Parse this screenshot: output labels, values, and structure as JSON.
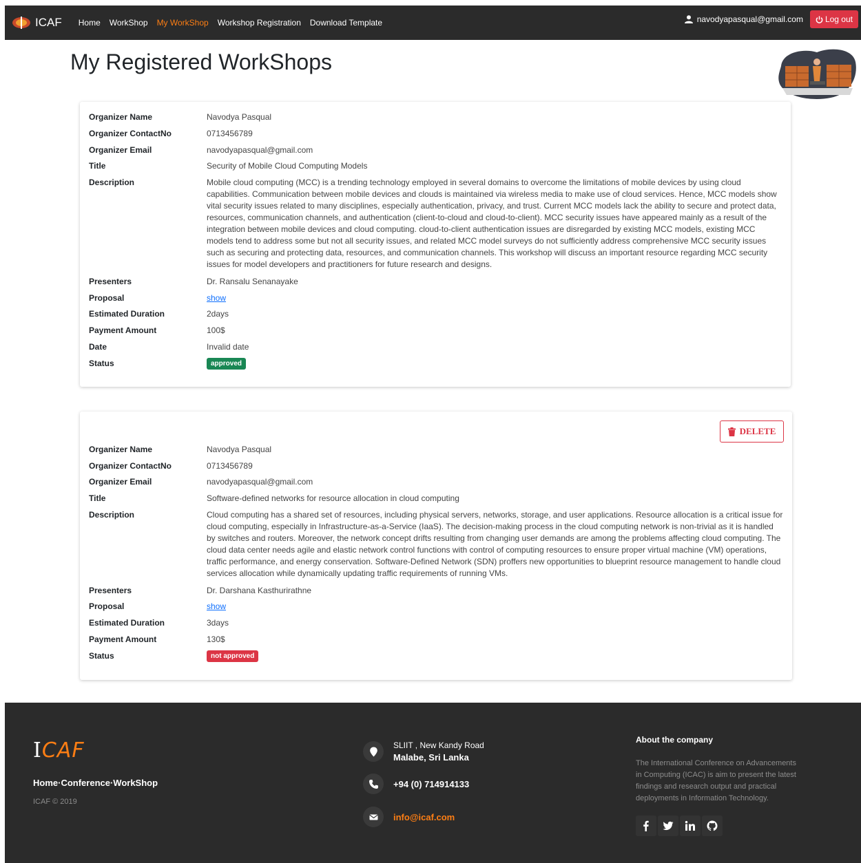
{
  "navbar": {
    "brand": "ICAF",
    "links": [
      "Home",
      "WorkShop",
      "My WorkShop",
      "Workshop Registration",
      "Download Template"
    ],
    "active_index": 2,
    "user_email": "navodyapasqual@gmail.com",
    "logout_label": "Log out"
  },
  "page": {
    "title": "My Registered WorkShops"
  },
  "labels": {
    "organizer_name": "Organizer Name",
    "organizer_contact": "Organizer ContactNo",
    "organizer_email": "Organizer Email",
    "title": "Title",
    "description": "Description",
    "presenters": "Presenters",
    "proposal": "Proposal",
    "duration": "Estimated Duration",
    "payment": "Payment Amount",
    "date": "Date",
    "status": "Status"
  },
  "workshops": [
    {
      "organizer_name": "Navodya Pasqual",
      "organizer_contact": "0713456789",
      "organizer_email": "navodyapasqual@gmail.com",
      "title": "Security of Mobile Cloud Computing Models",
      "description": "Mobile cloud computing (MCC) is a trending technology employed in several domains to overcome the limitations of mobile devices by using cloud capabilities. Communication between mobile devices and clouds is maintained via wireless media to make use of cloud services. Hence, MCC models show vital security issues related to many disciplines, especially authentication, privacy, and trust. Current MCC models lack the ability to secure and protect data, resources, communication channels, and authentication (client-to-cloud and cloud-to-client). MCC security issues have appeared mainly as a result of the integration between mobile devices and cloud computing. cloud-to-client authentication issues are disregarded by existing MCC models, existing MCC models tend to address some but not all security issues, and related MCC model surveys do not sufficiently address comprehensive MCC security issues such as securing and protecting data, resources, and communication channels. This workshop will discuss an important resource regarding MCC security issues for model developers and practitioners for future research and designs.",
      "presenters": "Dr. Ransalu Senanayake",
      "proposal": "show",
      "duration": "2days",
      "payment": "100$",
      "date": "Invalid date",
      "status": "approved"
    },
    {
      "delete_label": "DELETE",
      "organizer_name": "Navodya Pasqual",
      "organizer_contact": "0713456789",
      "organizer_email": "navodyapasqual@gmail.com",
      "title": "Software-defined networks for resource allocation in cloud computing",
      "description": "Cloud computing has a shared set of resources, including physical servers, networks, storage, and user applications. Resource allocation is a critical issue for cloud computing, especially in Infrastructure-as-a-Service (IaaS). The decision-making process in the cloud computing network is non-trivial as it is handled by switches and routers. Moreover, the network concept drifts resulting from changing user demands are among the problems affecting cloud computing. The cloud data center needs agile and elastic network control functions with control of computing resources to ensure proper virtual machine (VM) operations, traffic performance, and energy conservation. Software-Defined Network (SDN) proffers new opportunities to blueprint resource management to handle cloud services allocation while dynamically updating traffic requirements of running VMs.",
      "presenters": "Dr. Darshana Kasthurirathne",
      "proposal": "show",
      "duration": "3days",
      "payment": "130$",
      "status": "not approved"
    }
  ],
  "footer": {
    "logo_part1": "I",
    "logo_part2": "CAF",
    "links": "Home·Conference·WorkShop",
    "copyright": "ICAF © 2019",
    "address_line1": "SLIIT , New Kandy Road",
    "address_line2": "Malabe, Sri Lanka",
    "phone": "+94 (0) 714914133",
    "email": "info@icaf.com",
    "about_title": "About the company",
    "about_text": "The International Conference on Advancements in Computing (ICAC) is aim to present the latest findings and research output and practical deployments in Information Technology.",
    "social": [
      "facebook-icon",
      "twitter-icon",
      "linkedin-icon",
      "github-icon"
    ]
  },
  "colors": {
    "nav_bg": "#2b2b2b",
    "accent": "#fd7e14",
    "danger": "#dc3545",
    "success": "#198754",
    "link": "#0d6efd"
  }
}
